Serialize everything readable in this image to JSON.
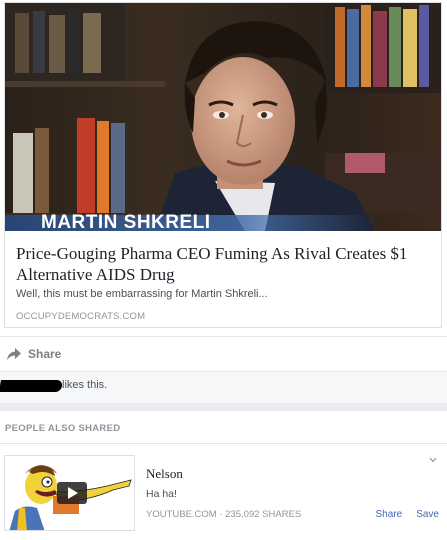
{
  "article": {
    "caption": "MARTIN SHKRELI",
    "title": "Price-Gouging Pharma CEO Fuming As Rival Creates $1 Alternative AIDS Drug",
    "description": "Well, this must be embarrassing for Martin Shkreli...",
    "source": "OCCUPYDEMOCRATS.COM"
  },
  "actions": {
    "share_label": "Share",
    "share_icon": "share-arrow-icon"
  },
  "likes": {
    "text": "likes this."
  },
  "people_also_shared": {
    "heading": "PEOPLE ALSO SHARED",
    "item": {
      "title": "Nelson",
      "subtitle": "Ha ha!",
      "meta": "YOUTUBE.COM · 235,092 SHARES",
      "share_label": "Share",
      "save_label": "Save"
    }
  },
  "colors": {
    "link": "#4267b2",
    "muted": "#90949c",
    "caption_band": "#2c4a80"
  }
}
